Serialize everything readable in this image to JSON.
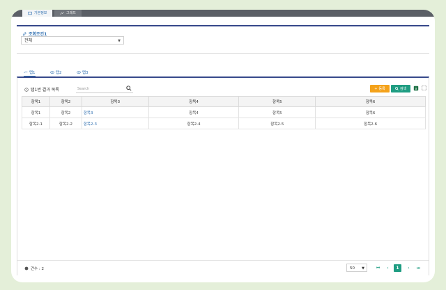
{
  "main_tabs": [
    {
      "label": "기본정보",
      "icon": "window-icon"
    },
    {
      "label": "그래프",
      "icon": "chart-line-icon"
    }
  ],
  "condition": {
    "label": "조회조건1",
    "icon": "edit-icon",
    "select_value": "전체"
  },
  "sub_tabs": [
    {
      "label": "탭1",
      "icon": "chart-line-icon"
    },
    {
      "label": "탭2",
      "icon": "eye-icon"
    },
    {
      "label": "탭3",
      "icon": "eye-icon"
    }
  ],
  "results": {
    "title": "탭1번 결과 목록",
    "title_icon": "clock-icon",
    "search_placeholder": "Search",
    "add_label": "등록",
    "search_label": "검색"
  },
  "table": {
    "headers": [
      "항목1",
      "항목2",
      "항목3",
      "항목4",
      "항목5",
      "항목6"
    ],
    "rows": [
      [
        "항목1",
        "항목2",
        "항목3",
        "항목4",
        "항목5",
        "항목6"
      ],
      [
        "항목2-1",
        "항목2-2",
        "항목2-3",
        "항목2-4",
        "항목2-5",
        "항목2-6"
      ]
    ]
  },
  "footer": {
    "count_label": "건수 : 2",
    "page_size": "50",
    "current_page": "1"
  },
  "colors": {
    "accent_green": "#1f9d82",
    "accent_orange": "#f4a21b",
    "header_navy": "#36488a",
    "link_blue": "#2f6fb0"
  }
}
